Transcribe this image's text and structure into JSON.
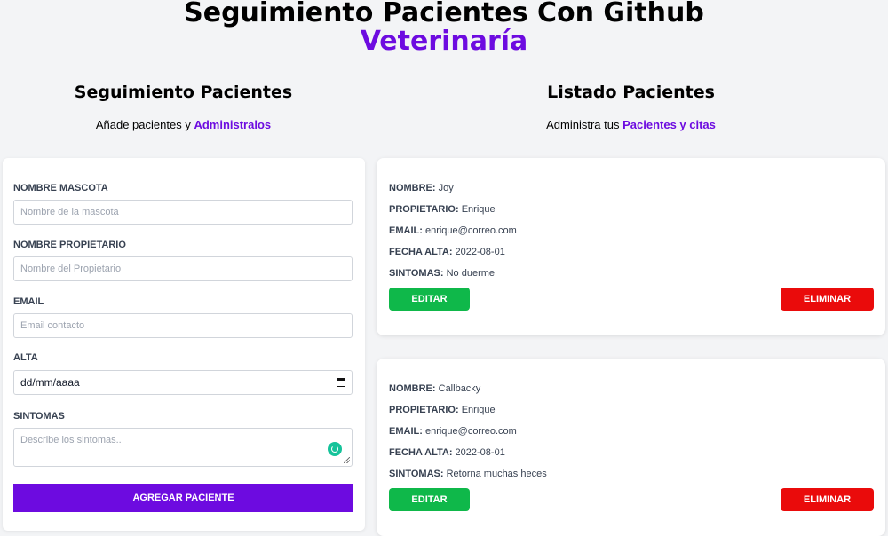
{
  "header": {
    "title": "Seguimiento Pacientes Con Github",
    "subtitle": "Veterinaría"
  },
  "form_section": {
    "heading": "Seguimiento Pacientes",
    "description_prefix": "Añade pacientes y ",
    "description_highlight": "Administralos"
  },
  "list_section": {
    "heading": "Listado Pacientes",
    "description_prefix": "Administra tus ",
    "description_highlight": "Pacientes y citas"
  },
  "form": {
    "pet_label": "Nombre Mascota",
    "pet_placeholder": "Nombre de la mascota",
    "owner_label": "Nombre Propietario",
    "owner_placeholder": "Nombre del Propietario",
    "email_label": "Email",
    "email_placeholder": "Email contacto",
    "date_label": "Alta",
    "date_value": "dd/mm/aaaa",
    "symptoms_label": "Sintomas",
    "symptoms_placeholder": "Describe los sintomas..",
    "submit_label": "Agregar Paciente"
  },
  "patient_labels": {
    "name": "Nombre:",
    "owner": "Propietario:",
    "email": "Email:",
    "date": "Fecha Alta:",
    "symptoms": "Sintomas:",
    "edit": "Editar",
    "delete": "Eliminar"
  },
  "patients": [
    {
      "name": "Joy",
      "owner": "Enrique",
      "email": "enrique@correo.com",
      "date": "2022-08-01",
      "symptoms": "No duerme"
    },
    {
      "name": "Callbacky",
      "owner": "Enrique",
      "email": "enrique@correo.com",
      "date": "2022-08-01",
      "symptoms": "Retorna muchas heces"
    }
  ],
  "colors": {
    "accent": "#6d0be0",
    "edit_button": "#0fb84a",
    "delete_button": "#ea0b0b",
    "background": "#f3f4f6"
  },
  "icons": [
    "calendar-icon",
    "grammar-assistant-icon",
    "resize-grip-icon"
  ]
}
